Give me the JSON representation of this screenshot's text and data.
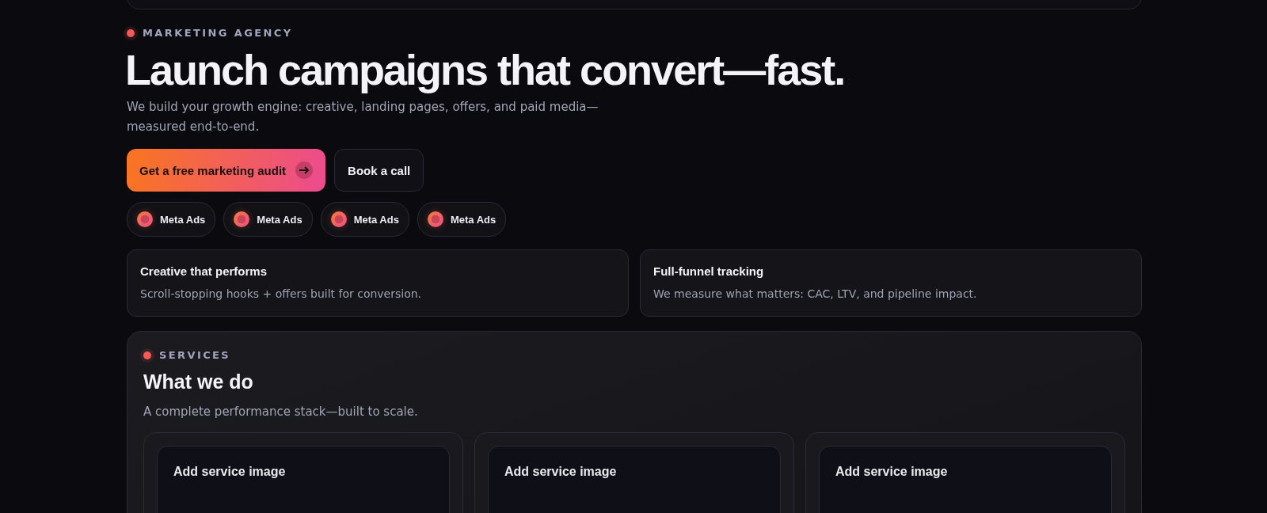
{
  "hero": {
    "eyebrow": "MARKETING AGENCY",
    "title": "Launch campaigns that convert—fast.",
    "subtitle": "We build your growth engine: creative, landing pages, offers, and paid media—measured end-to-end.",
    "primary_button": "Get a free marketing audit",
    "secondary_button": "Book a call",
    "chips": [
      {
        "label": "Meta Ads"
      },
      {
        "label": "Meta Ads"
      },
      {
        "label": "Meta Ads"
      },
      {
        "label": "Meta Ads"
      }
    ],
    "features": [
      {
        "title": "Creative that performs",
        "text": "Scroll-stopping hooks + offers built for conversion."
      },
      {
        "title": "Full-funnel tracking",
        "text": "We measure what matters: CAC, LTV, and pipeline impact."
      }
    ]
  },
  "services": {
    "eyebrow": "SERVICES",
    "title": "What we do",
    "subtitle": "A complete performance stack—built to scale.",
    "cards": [
      {
        "image_label": "Add service image"
      },
      {
        "image_label": "Add service image"
      },
      {
        "image_label": "Add service image"
      }
    ]
  }
}
